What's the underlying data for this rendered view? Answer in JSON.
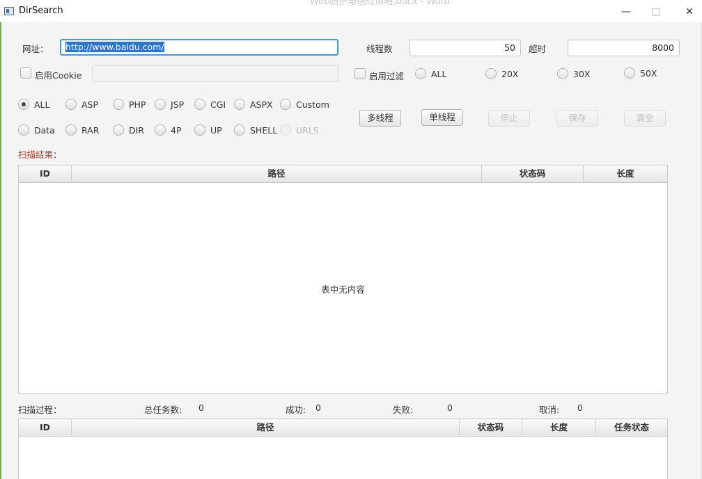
{
  "window": {
    "title": "DirSearch",
    "background_title": "Web防护与绕过策略.docx - Word",
    "minimize": "—",
    "maximize": "□",
    "close": "✕"
  },
  "form": {
    "url_label": "网址：",
    "url_value": "http://www.baidu.com/",
    "threads_label": "线程数",
    "threads_value": "50",
    "timeout_label": "超时",
    "timeout_value": "8000",
    "cookie_label": "启用Cookie",
    "cookie_value": "",
    "filter_label": "启用过滤"
  },
  "status_filters": [
    {
      "label": "ALL",
      "selected": false
    },
    {
      "label": "20X",
      "selected": false
    },
    {
      "label": "30X",
      "selected": false
    },
    {
      "label": "50X",
      "selected": false
    }
  ],
  "dict_types_row1": [
    {
      "label": "ALL",
      "selected": true,
      "enabled": true
    },
    {
      "label": "ASP",
      "selected": false,
      "enabled": true
    },
    {
      "label": "PHP",
      "selected": false,
      "enabled": true
    },
    {
      "label": "JSP",
      "selected": false,
      "enabled": true
    },
    {
      "label": "CGI",
      "selected": false,
      "enabled": true
    },
    {
      "label": "ASPX",
      "selected": false,
      "enabled": true
    },
    {
      "label": "Custom",
      "selected": false,
      "enabled": true
    }
  ],
  "dict_types_row2": [
    {
      "label": "Data",
      "selected": false,
      "enabled": true
    },
    {
      "label": "RAR",
      "selected": false,
      "enabled": true
    },
    {
      "label": "DIR",
      "selected": false,
      "enabled": true
    },
    {
      "label": "4P",
      "selected": false,
      "enabled": true
    },
    {
      "label": "UP",
      "selected": false,
      "enabled": true
    },
    {
      "label": "SHELL",
      "selected": false,
      "enabled": true
    },
    {
      "label": "URLS",
      "selected": false,
      "enabled": false
    }
  ],
  "buttons": {
    "multi_thread": "多线程",
    "single_thread": "单线程",
    "stop": "停止",
    "save": "保存",
    "clear": "清空"
  },
  "results": {
    "label": "扫描结果：",
    "columns": [
      "ID",
      "路径",
      "状态码",
      "长度"
    ],
    "rows": [],
    "empty_text": "表中无内容"
  },
  "progress": {
    "label": "扫描过程：",
    "total_label": "总任务数:",
    "total_value": "0",
    "success_label": "成功:",
    "success_value": "0",
    "fail_label": "失败:",
    "fail_value": "0",
    "cancel_label": "取消:",
    "cancel_value": "0",
    "columns": [
      "ID",
      "路径",
      "状态码",
      "长度",
      "任务状态"
    ],
    "rows": []
  },
  "colors": {
    "accent": "#3d9bd8",
    "selection": "#2c74c9",
    "section_label": "#c0392b"
  }
}
